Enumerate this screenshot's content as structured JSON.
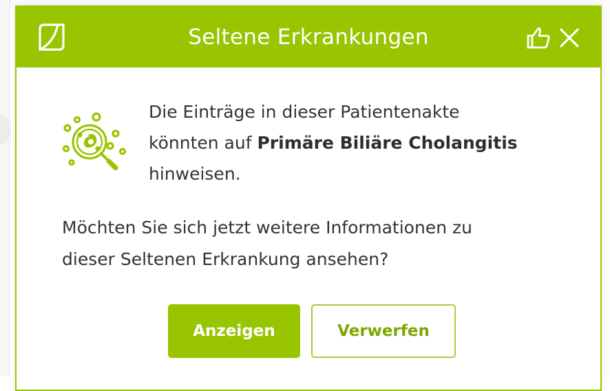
{
  "dialog": {
    "title": "Seltene Erkrankungen",
    "message": {
      "line1": "Die Einträge in dieser Patientenakte",
      "line2_prefix": "könnten auf ",
      "disease": "Primäre Biliäre Cholangitis",
      "line3": "hinweisen."
    },
    "question": {
      "line1": "Möchten Sie sich jetzt weitere Informationen zu",
      "line2": "dieser Seltenen Erkrankung ansehen?"
    },
    "buttons": {
      "show_label": "Anzeigen",
      "dismiss_label": "Verwerfen"
    }
  },
  "icons": {
    "logo": "logo-icon",
    "feedback": "thumbs-up-icon",
    "close": "close-icon",
    "disease": "rare-disease-magnifier-icon"
  },
  "colors": {
    "accent": "#99c400",
    "text": "#333333",
    "dismiss_text": "#7fa600"
  }
}
